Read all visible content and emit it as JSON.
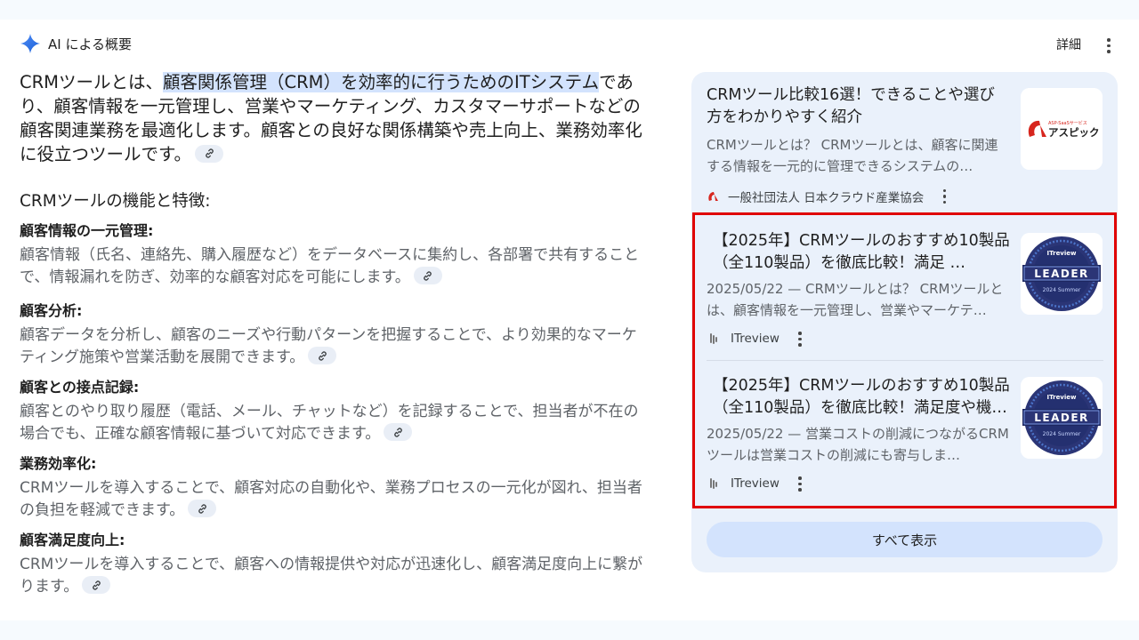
{
  "header": {
    "title": "AI による概要",
    "detail_label": "詳細"
  },
  "intro": {
    "before": "CRMツールとは、",
    "highlight": "顧客関係管理（CRM）を効率的に行うためのITシステム",
    "after": "であり、顧客情報を一元管理し、営業やマーケティング、カスタマーサポートなどの顧客関連業務を最適化します。顧客との良好な関係構築や売上向上、業務効率化に役立つツールです。"
  },
  "features_heading": "CRMツールの機能と特徴:",
  "features": [
    {
      "title": "顧客情報の一元管理:",
      "desc": "顧客情報（氏名、連絡先、購入履歴など）をデータベースに集約し、各部署で共有することで、情報漏れを防ぎ、効率的な顧客対応を可能にします。"
    },
    {
      "title": "顧客分析:",
      "desc": "顧客データを分析し、顧客のニーズや行動パターンを把握することで、より効果的なマーケティング施策や営業活動を展開できます。"
    },
    {
      "title": "顧客との接点記録:",
      "desc": "顧客とのやり取り履歴（電話、メール、チャットなど）を記録することで、担当者が不在の場合でも、正確な顧客情報に基づいて対応できます。"
    },
    {
      "title": "業務効率化:",
      "desc": "CRMツールを導入することで、顧客対応の自動化や、業務プロセスの一元化が図れ、担当者の負担を軽減できます。"
    },
    {
      "title": "顧客満足度向上:",
      "desc": "CRMツールを導入することで、顧客への情報提供や対応が迅速化し、顧客満足度向上に繋がります。"
    }
  ],
  "sources": [
    {
      "title": "CRMツール比較16選！できることや選び方をわかりやすく紹介",
      "snippet": "CRMツールとは？ CRMツールとは、顧客に関連する情報を一元的に管理できるシステムの…",
      "source": "一般社団法人 日本クラウド産業協会",
      "thumb_small": "ASP-SaaSサービス",
      "thumb_brand": "アスピック"
    },
    {
      "title": "【2025年】CRMツールのおすすめ10製品（全110製品）を徹底比較！満足 …",
      "snippet": "2025/05/22 — CRMツールとは？ CRMツールとは、顧客情報を一元管理し、営業やマーケテ…",
      "source": "ITreview",
      "badge_top": "ITreview",
      "badge_main": "LEADER",
      "badge_sub": "2024 Summer"
    },
    {
      "title": "【2025年】CRMツールのおすすめ10製品（全110製品）を徹底比較！満足度や機…",
      "snippet": "2025/05/22 — 営業コストの削減につながるCRMツールは営業コストの削減にも寄与しま…",
      "source": "ITreview",
      "badge_top": "ITreview",
      "badge_main": "LEADER",
      "badge_sub": "2024 Summer"
    }
  ],
  "show_all_label": "すべて表示",
  "colors": {
    "highlight": "#d3e3fd",
    "panel": "#eaf1fb",
    "annotation_box": "#e00000",
    "badge_navy": "#2b3576"
  }
}
